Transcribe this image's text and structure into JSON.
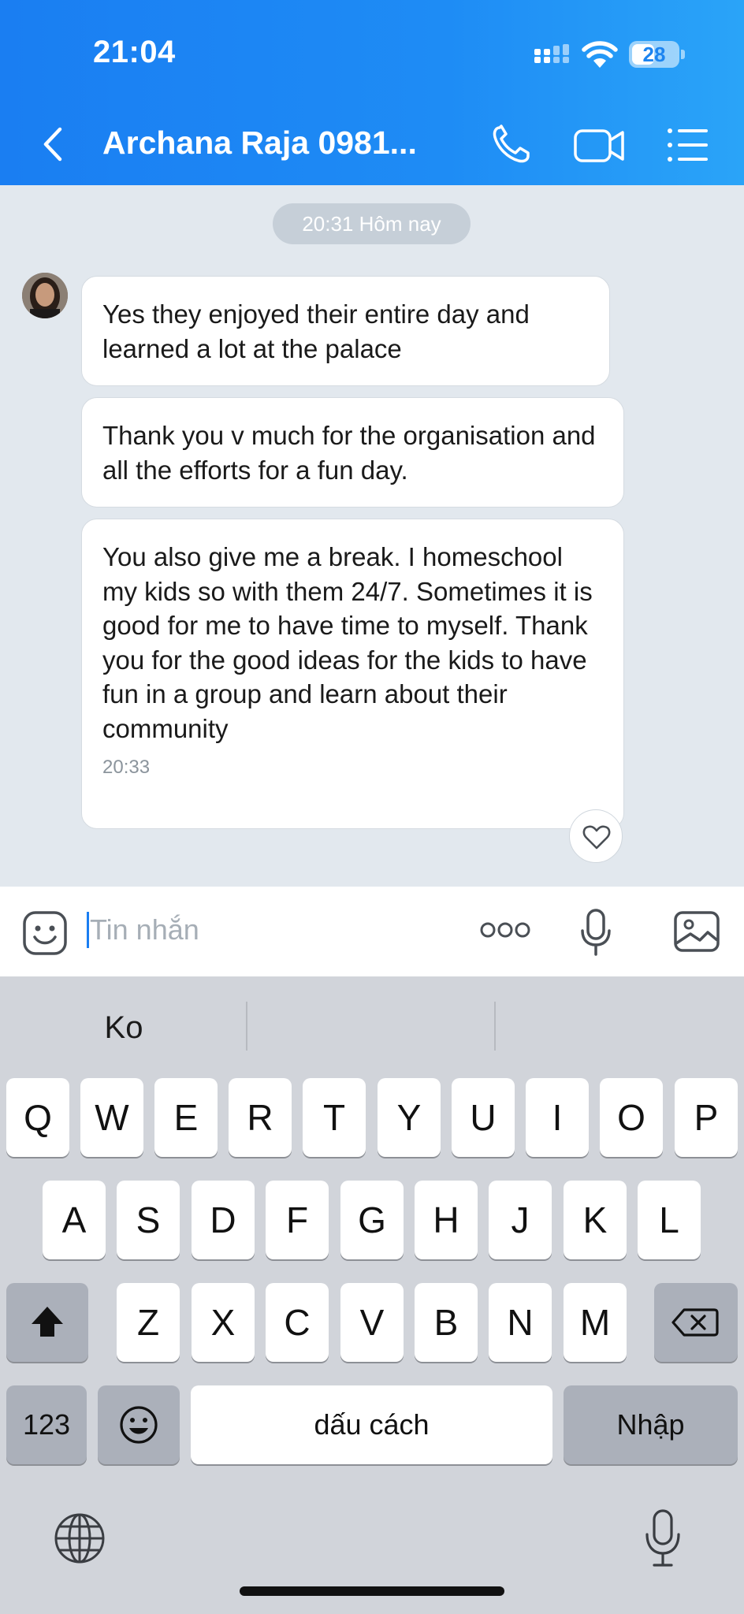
{
  "status_bar": {
    "time": "21:04",
    "battery": "28"
  },
  "header": {
    "contact_name": "Archana Raja 0981..."
  },
  "chat": {
    "date_separator": "20:31 Hôm nay",
    "messages": [
      {
        "text": "Yes they enjoyed their entire day and learned a lot at the palace"
      },
      {
        "text": "Thank you v much for the organisation and all the efforts for a fun day."
      },
      {
        "text": "You also give me a break. I homeschool my kids so with them 24/7. Sometimes it is good for me to have time to myself. Thank you for the good ideas for the kids to have fun in a group and learn about their community",
        "time": "20:33"
      }
    ]
  },
  "input": {
    "placeholder": "Tin nhắn"
  },
  "keyboard": {
    "suggestions": [
      "Ko",
      "",
      ""
    ],
    "row1": [
      "Q",
      "W",
      "E",
      "R",
      "T",
      "Y",
      "U",
      "I",
      "O",
      "P"
    ],
    "row2": [
      "A",
      "S",
      "D",
      "F",
      "G",
      "H",
      "J",
      "K",
      "L"
    ],
    "row3": [
      "Z",
      "X",
      "C",
      "V",
      "B",
      "N",
      "M"
    ],
    "numbers_key": "123",
    "space_key": "dấu cách",
    "return_key": "Nhập"
  },
  "colors": {
    "accent": "#1a7ef2",
    "chat_bg": "#e2e8ee",
    "keyboard_bg": "#d1d4da"
  }
}
